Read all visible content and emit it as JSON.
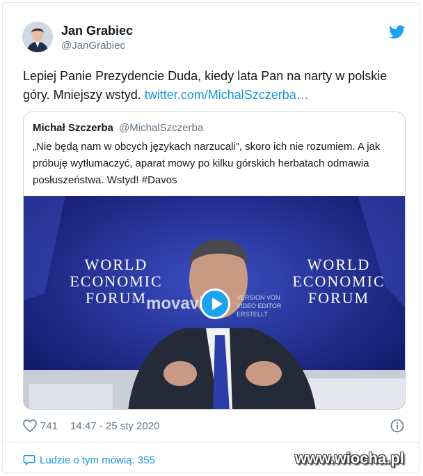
{
  "tweet": {
    "author_name": "Jan Grabiec",
    "author_handle": "@JanGrabiec",
    "text": "Lepiej Panie Prezydencie Duda, kiedy lata Pan na narty w polskie góry. Mniejszy wstyd. ",
    "link_text": "twitter.com/MichalSzczerba…",
    "like_count": "741",
    "timestamp": "14:47 - 25 sty 2020",
    "people_talking": "Ludzie o tym mówią: 355"
  },
  "quoted_tweet": {
    "author_name": "Michał Szczerba",
    "author_handle": "@MichalSzczerba",
    "text": "„Nie będą nam w obcych językach narzucali”, skoro ich nie rozumiem. A jak próbuję wytłumaczyć, aparat mowy po kilku górskich herbatach odmawia posłuszeństwa. Wstyd! #Davos"
  },
  "video": {
    "backdrop_left": "WORLD\nECONOMIC\nFORUM",
    "backdrop_right": "WORLD\nECONOMIC\nFORUM",
    "watermark_logo": "movavi",
    "watermark_note": "VERSION VON\nVIDEO EDITOR ERSTELLT"
  },
  "site_watermark": "www.wiocha.pl",
  "colors": {
    "link": "#1b95e0",
    "twitter_blue": "#1da1f2",
    "secondary_text": "#657786",
    "video_background": "#1e2a8f"
  },
  "icons": {
    "twitter": "twitter-bird-icon",
    "like": "heart-icon",
    "info": "info-icon",
    "comments": "speech-bubble-icon",
    "play": "play-icon"
  }
}
